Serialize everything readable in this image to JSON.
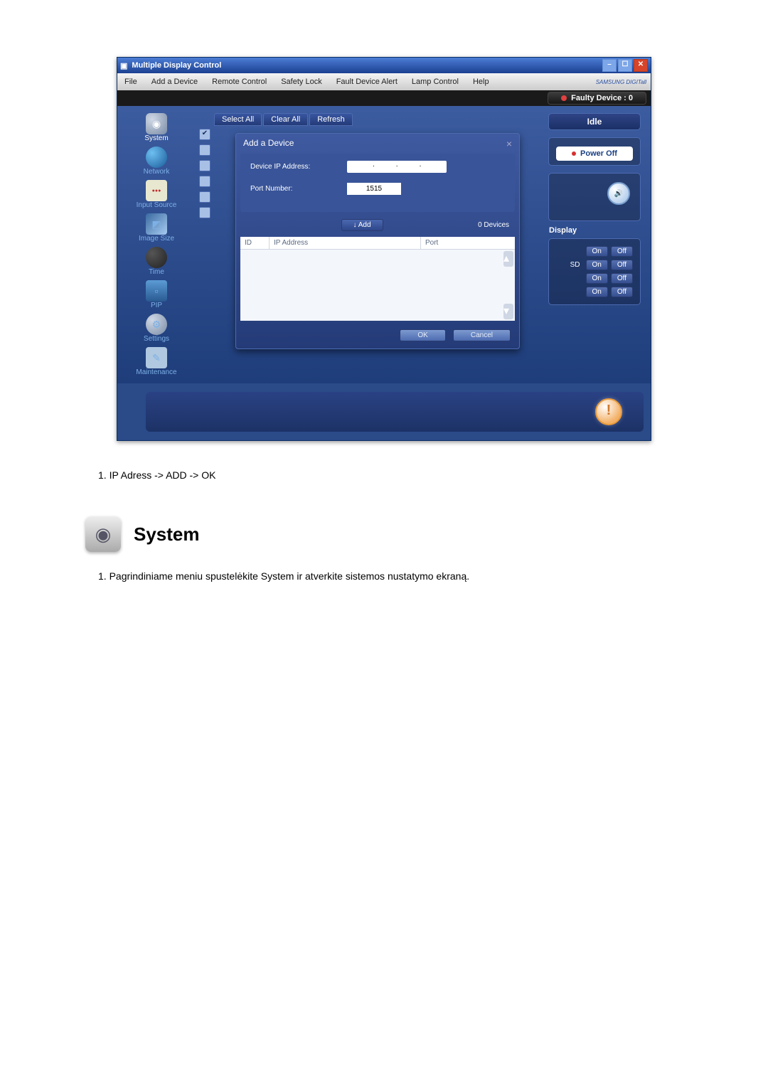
{
  "window": {
    "title": "Multiple Display Control"
  },
  "menu": {
    "file": "File",
    "add_device": "Add a Device",
    "remote_control": "Remote Control",
    "safety_lock": "Safety Lock",
    "fault_alert": "Fault Device Alert",
    "lamp_control": "Lamp Control",
    "help": "Help",
    "brand": "SAMSUNG DIGITall"
  },
  "status_bar": {
    "faulty": "Faulty Device : 0"
  },
  "sidebar": {
    "items": [
      {
        "label": "System"
      },
      {
        "label": "Network"
      },
      {
        "label": "Input Source"
      },
      {
        "label": "Image Size"
      },
      {
        "label": "Time"
      },
      {
        "label": "PIP"
      },
      {
        "label": "Settings"
      },
      {
        "label": "Maintenance"
      }
    ]
  },
  "tabs": {
    "select_all": "Select All",
    "clear_all": "Clear All",
    "refresh": "Refresh"
  },
  "dialog": {
    "title": "Add a Device",
    "ip_label": "Device IP Address:",
    "port_label": "Port Number:",
    "port_value": "1515",
    "add_button": "Add",
    "devices_count": "0 Devices",
    "col_id": "ID",
    "col_ip": "IP Address",
    "col_port": "Port",
    "ok": "OK",
    "cancel": "Cancel"
  },
  "right": {
    "idle": "Idle",
    "power_off": "Power Off",
    "display": "Display",
    "sd": "SD",
    "on": "On",
    "off": "Off"
  },
  "body": {
    "line1": "1. IP Adress -> ADD -> OK",
    "section_title": "System",
    "line2": "1. Pagrindiniame meniu spustelėkite System ir atverkite sistemos nustatymo ekraną."
  }
}
